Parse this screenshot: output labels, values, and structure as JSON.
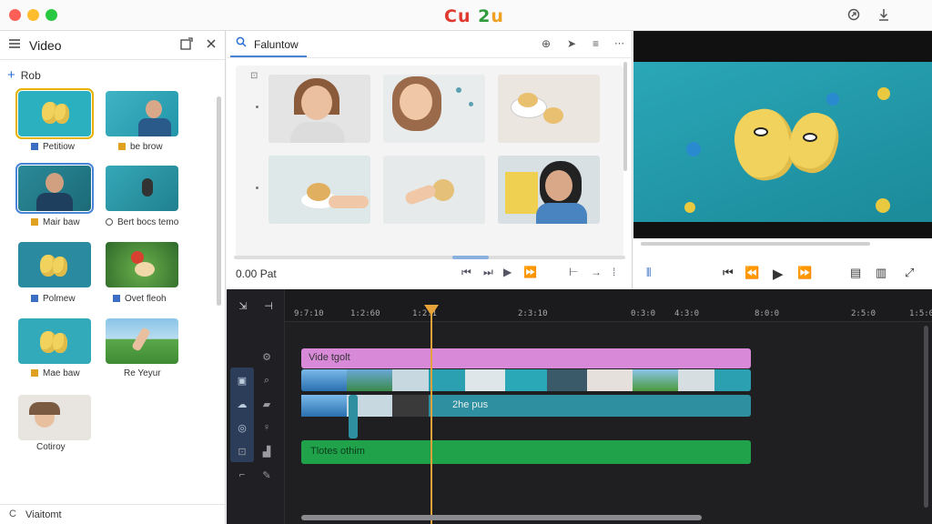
{
  "window": {
    "logo": {
      "p1": "Cu",
      "p2": " 2",
      "p3": "u"
    }
  },
  "left_panel": {
    "title": "Video",
    "add_label": "Rob",
    "items": [
      {
        "label": "Petitiow",
        "color": "#3a6fc4"
      },
      {
        "label": "be brow",
        "color": "#e0a020"
      },
      {
        "label": "Mair baw",
        "color": "#e0a020"
      },
      {
        "label": "Bert bocs temo",
        "color": "#555555"
      },
      {
        "label": "Polmew",
        "color": "#3a6fc4"
      },
      {
        "label": "Ovet fleoh",
        "color": "#3a6fc4"
      },
      {
        "label": "Mae baw",
        "color": "#e0a020"
      },
      {
        "label": "Re Yeyur",
        "color": ""
      },
      {
        "label": "Cotiroy",
        "color": ""
      }
    ],
    "footer": "Viaitomt"
  },
  "media": {
    "search_text": "Faluntow",
    "time": "0.00 Pat"
  },
  "timeline": {
    "ruler": [
      "9:7:10",
      "1:2:60",
      "1:2:1",
      "2:3:10",
      "0:3:0",
      "4:3:0",
      "8:0:0",
      "2:5:0",
      "1:5:0"
    ],
    "tracks": {
      "video_title": "Vide tgolt",
      "broll": "2he pus",
      "audio": "Tlotes othim"
    }
  },
  "icons": [
    "close-icon",
    "search-icon",
    "play-icon",
    "prev-icon",
    "next-icon",
    "rewind-icon",
    "fast-forward-icon",
    "share-icon",
    "download-icon",
    "add-icon",
    "gear-icon"
  ]
}
